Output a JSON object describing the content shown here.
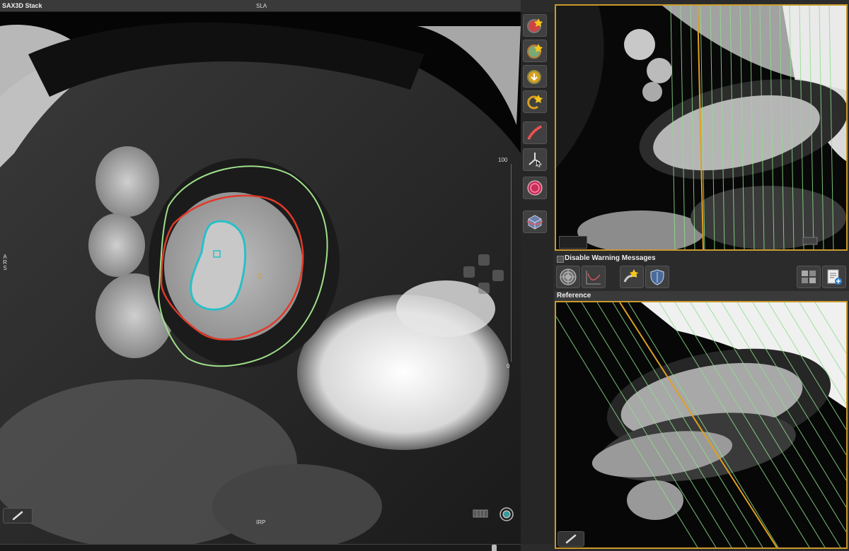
{
  "main_viewer": {
    "title": "SAX3D Stack",
    "orientation": {
      "top": "SLA",
      "left": "ARS",
      "bottom": "IRP"
    },
    "scale": {
      "max": "100",
      "min": "0"
    }
  },
  "toolbar": {
    "tools": [
      {
        "name": "endocardium-contour-tool",
        "icon": "heart-contour-red-icon"
      },
      {
        "name": "epicardium-contour-tool",
        "icon": "heart-contour-green-icon"
      },
      {
        "name": "auto-contour-tool",
        "icon": "auto-contour-icon"
      },
      {
        "name": "copy-contour-tool",
        "icon": "copy-contour-icon"
      },
      {
        "name": "spline-tool",
        "icon": "spline-pen-icon"
      },
      {
        "name": "pointer-tool",
        "icon": "pointer-icon"
      },
      {
        "name": "roi-circle-tool",
        "icon": "roi-circle-icon"
      },
      {
        "name": "3d-view-tool",
        "icon": "cube-view-icon"
      }
    ]
  },
  "right_panel": {
    "warning_label": "Disable Warning Messages",
    "reference_title": "Reference",
    "buttons": [
      {
        "name": "bullseye-button",
        "icon": "bullseye-icon"
      },
      {
        "name": "curve-chart-button",
        "icon": "curve-chart-icon"
      },
      {
        "name": "auto-propagate-button",
        "icon": "propagate-icon"
      },
      {
        "name": "shield-button",
        "icon": "shield-icon"
      },
      {
        "name": "layout-button",
        "icon": "layout-grid-icon"
      },
      {
        "name": "report-add-button",
        "icon": "report-add-icon"
      }
    ]
  },
  "colors": {
    "accent_border": "#c99a2e",
    "endocardium": "#e03a2a",
    "epicardium": "#9fe08a",
    "blood_pool": "#27c0c8",
    "reference_lines": "#8ee08a",
    "reference_active": "#e0a020"
  }
}
